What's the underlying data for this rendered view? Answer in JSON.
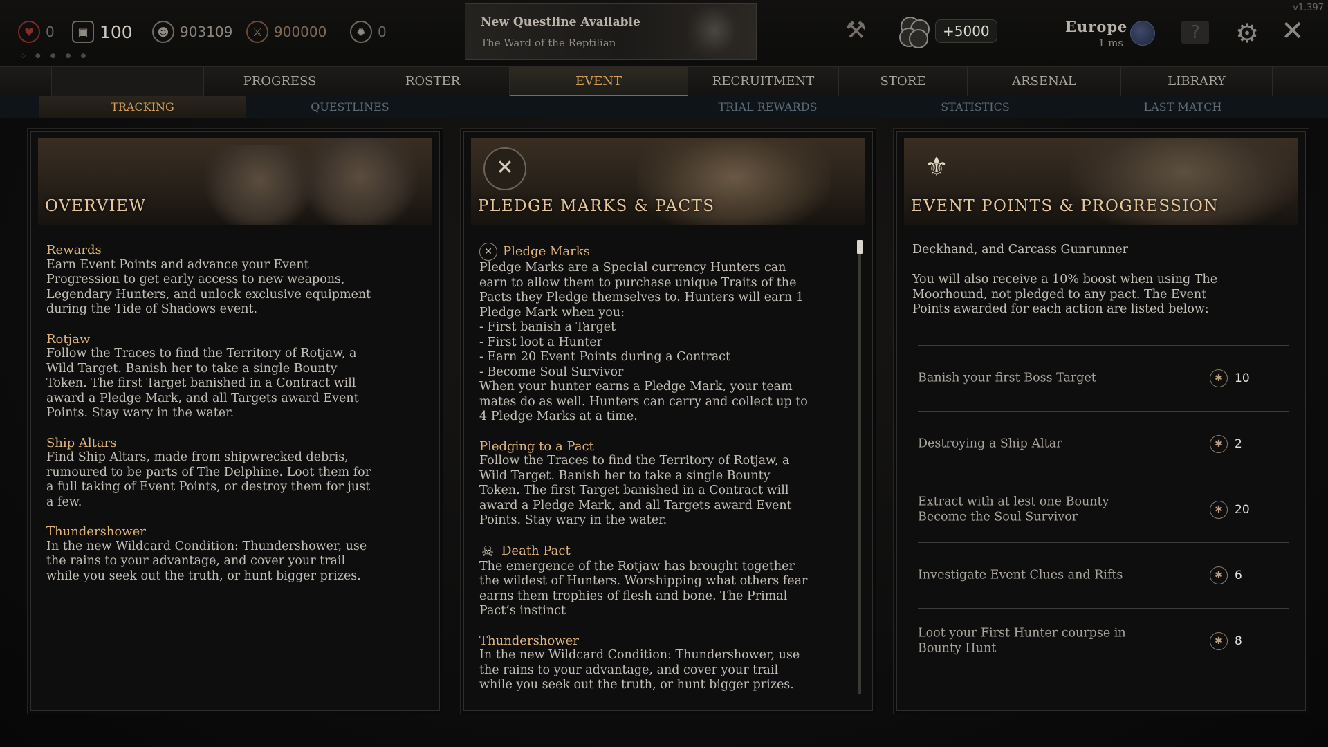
{
  "version": "v1.397",
  "topbar": {
    "blood_bonds": "0",
    "hunt_tokens": "100",
    "hunt_dollars": "903109",
    "event_currency": "900000",
    "pledge_marks": "0",
    "bonus": "+5000",
    "region": "Europe",
    "ping": "1 ms",
    "help_glyph": "?",
    "icons": [
      "blood-bond-icon",
      "hunt-token-icon",
      "hunt-dollar-icon",
      "event-currency-icon",
      "pledge-mark-icon",
      "weapon-icon",
      "coins-icon",
      "globe-icon",
      "help-icon",
      "gear-icon",
      "close-icon"
    ]
  },
  "notification": {
    "title": "New Questline Available",
    "subtitle": "The Ward of the Reptilian"
  },
  "nav": {
    "tabs": [
      "PROGRESS",
      "ROSTER",
      "EVENT",
      "RECRUITMENT",
      "STORE",
      "ARSENAL",
      "LIBRARY"
    ],
    "active": "EVENT"
  },
  "subnav": {
    "tabs": [
      "TRACKING",
      "QUESTLINES",
      "TRIAL REWARDS",
      "STATISTICS",
      "LAST MATCH"
    ],
    "active": "TRACKING"
  },
  "overview": {
    "title": "OVERVIEW",
    "sections": [
      {
        "heading": "Rewards",
        "text": "Earn Event Points and advance your Event\nProgression to get early access to new weapons,\nLegendary Hunters, and unlock exclusive equipment\nduring the Tide of Shadows event."
      },
      {
        "heading": "Rotjaw",
        "text": "Follow the Traces to find the Territory of Rotjaw, a\nWild Target. Banish her to take a single Bounty\nToken. The first Target banished in a Contract will\naward a Pledge Mark, and all Targets award Event\nPoints. Stay wary in the water."
      },
      {
        "heading": "Ship Altars",
        "text": "Find Ship Altars, made from shipwrecked debris,\nrumoured to be parts of The Delphine. Loot them for\na full taking of Event Points, or destroy them for just\na few."
      },
      {
        "heading": "Thundershower",
        "text": "In the new Wildcard Condition: Thundershower, use\nthe rains to your advantage, and cover your trail\nwhile you seek out the truth, or hunt bigger prizes."
      }
    ]
  },
  "pledge": {
    "title": "PLEDGE MARKS & PACTS",
    "emblem_glyph": "✕",
    "sections": [
      {
        "heading": "Pledge Marks",
        "icon": "✕",
        "text": "Pledge Marks are a Special currency Hunters can\nearn to allow them to purchase unique Traits of the\nPacts they Pledge themselves to. Hunters will earn 1\nPledge Mark when you:\n- First banish a Target\n- First loot a Hunter\n- Earn 20 Event Points during a Contract\n- Become Soul Survivor\nWhen your hunter earns a Pledge Mark, your team\nmates do as well. Hunters can carry and collect up to\n4 Pledge Marks at a time."
      },
      {
        "heading": "Pledging to a Pact",
        "icon": "",
        "text": "Follow the Traces to find the Territory of Rotjaw, a\nWild Target. Banish her to take a single Bounty\nToken. The first Target banished in a Contract will\naward a Pledge Mark, and all Targets award Event\nPoints. Stay wary in the water."
      },
      {
        "heading": "Death Pact",
        "icon": "☠",
        "text": "The emergence of the Rotjaw has brought together\nthe wildest of Hunters. Worshipping what others fear\nearns them trophies of flesh and bone. The Primal\nPact’s instinct"
      },
      {
        "heading": "Thundershower",
        "icon": "",
        "text": "In the new Wildcard Condition: Thundershower, use\nthe rains to your advantage, and cover your trail\nwhile you seek out the truth, or hunt bigger prizes."
      }
    ]
  },
  "event_points": {
    "title": "EVENT POINTS & PROGRESSION",
    "emblem_glyph": "⚜",
    "intro": "Deckhand, and Carcass Gunrunner\n\nYou will also receive a 10% boost when using The\nMoorhound, not pledged to any pact. The Event\nPoints awarded for each action are listed below:",
    "point_icon": "✱",
    "rows": [
      {
        "label": "Banish your first Boss Target",
        "points": "10"
      },
      {
        "label": "Destroying a Ship Altar",
        "points": "2"
      },
      {
        "label": "Extract with at lest one Bounty\nBecome the Soul Survivor",
        "points": "20"
      },
      {
        "label": "Investigate Event Clues and Rifts",
        "points": "6"
      },
      {
        "label": "Loot your First Hunter courpse in\nBounty Hunt",
        "points": "8"
      }
    ]
  }
}
